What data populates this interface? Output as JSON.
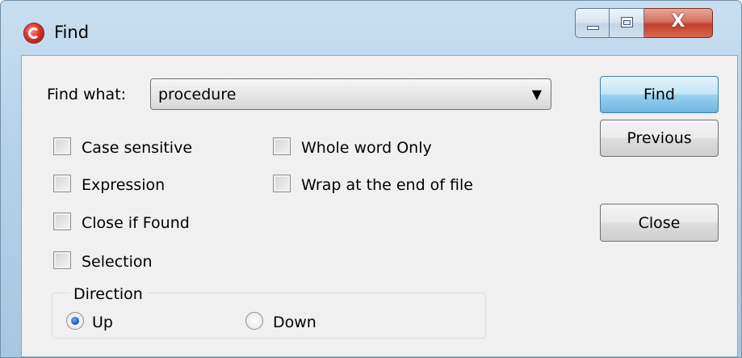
{
  "window": {
    "title": "Find",
    "icon": "app-logo-icon",
    "caption": {
      "minimize": "minimize-icon",
      "maximize": "maximize-icon",
      "close_glyph": "X"
    }
  },
  "find_what": {
    "label": "Find what:",
    "value": "procedure",
    "dropdown_arrow": "▼"
  },
  "buttons": {
    "find": "Find",
    "previous": "Previous",
    "close": "Close"
  },
  "options": {
    "case_sensitive": {
      "label": "Case sensitive",
      "checked": false
    },
    "expression": {
      "label": "Expression",
      "checked": false
    },
    "close_if_found": {
      "label": "Close if Found",
      "checked": false
    },
    "selection": {
      "label": "Selection",
      "checked": false
    },
    "whole_word_only": {
      "label": "Whole word Only",
      "checked": false
    },
    "wrap_at_end": {
      "label": "Wrap at the end of file",
      "checked": false
    }
  },
  "direction": {
    "legend": "Direction",
    "up": {
      "label": "Up",
      "selected": true
    },
    "down": {
      "label": "Down",
      "selected": false
    }
  },
  "colors": {
    "frame": "#b8d3ea",
    "client": "#f0f0f0",
    "default_button": "#98d1ef",
    "close_button": "#c0402a"
  }
}
